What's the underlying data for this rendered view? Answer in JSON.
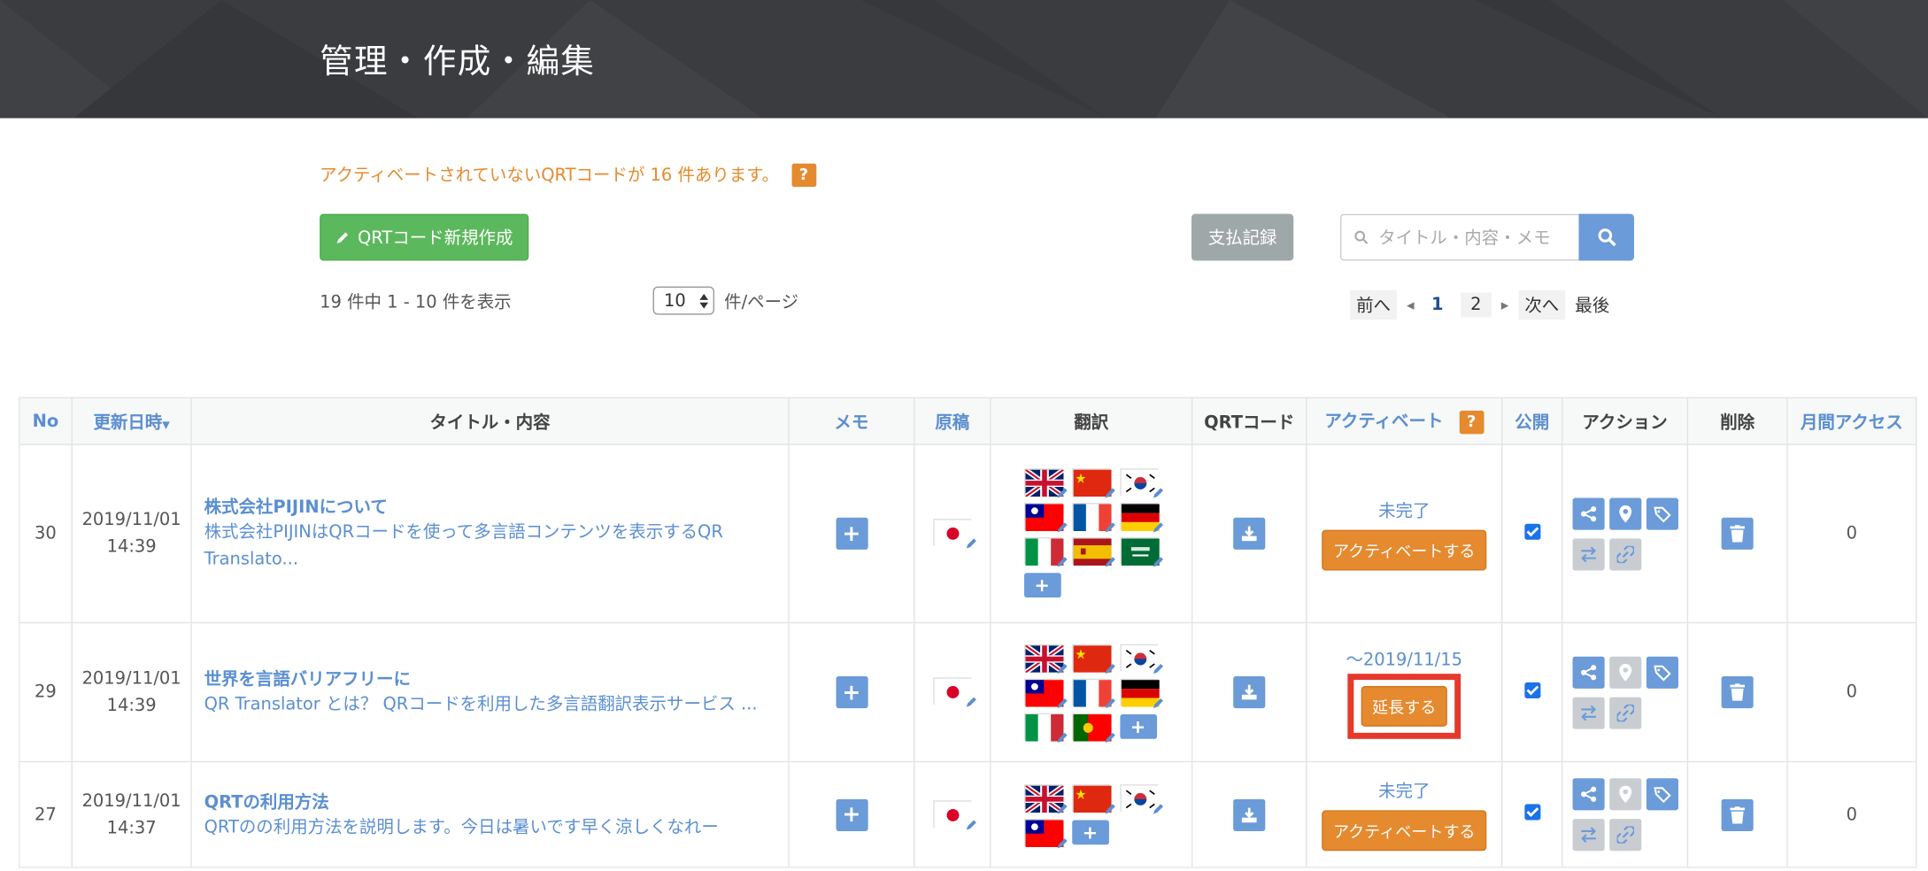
{
  "header": {
    "title": "管理・作成・編集"
  },
  "notice": {
    "text": "アクティベートされていないQRTコードが 16 件あります。",
    "help": "?"
  },
  "toolbar": {
    "new_label": "QRTコード新規作成",
    "payments_label": "支払記録",
    "search_placeholder": "タイトル・内容・メモ"
  },
  "listing": {
    "count_text": "19 件中 1 - 10 件を表示",
    "per_page_value": "10",
    "per_page_suffix": "件/ページ"
  },
  "pagination": {
    "prev": "前へ",
    "pages": [
      "1",
      "2"
    ],
    "current": "1",
    "next": "次へ",
    "last": "最後"
  },
  "table": {
    "headers": {
      "no": "No",
      "updated": "更新日時",
      "title": "タイトル・内容",
      "memo": "メモ",
      "original": "原稿",
      "translation": "翻訳",
      "qrt": "QRTコード",
      "activate": "アクティベート",
      "activate_help": "?",
      "public": "公開",
      "action": "アクション",
      "delete": "削除",
      "monthly": "月間アクセス"
    },
    "rows": [
      {
        "no": "30",
        "date": "2019/11/01",
        "time": "14:39",
        "title": "株式会社PIJINについて",
        "summary": "株式会社PIJINはQRコードを使って多言語コンテンツを表示するQR Translato...",
        "status": "未完了",
        "action_label": "アクティベートする",
        "monthly": "0"
      },
      {
        "no": "29",
        "date": "2019/11/01",
        "time": "14:39",
        "title": "世界を言語バリアフリーに",
        "summary": "QR Translator とは？ QRコードを利用した多言語翻訳表示サービス ...",
        "status": "〜2019/11/15",
        "action_label": "延長する",
        "monthly": "0"
      },
      {
        "no": "27",
        "date": "2019/11/01",
        "time": "14:37",
        "title": "QRTの利用方法",
        "summary": "QRTのの利用方法を説明します。今日は暑いです早く涼しくなれー",
        "status": "未完了",
        "action_label": "アクティベートする",
        "monthly": "0"
      }
    ]
  },
  "colors": {
    "header_bg": "#3b3c40",
    "accent_blue": "#6b9bd8",
    "accent_orange": "#e58a2e",
    "green": "#5cb85c",
    "highlight_red": "#e5392c"
  }
}
